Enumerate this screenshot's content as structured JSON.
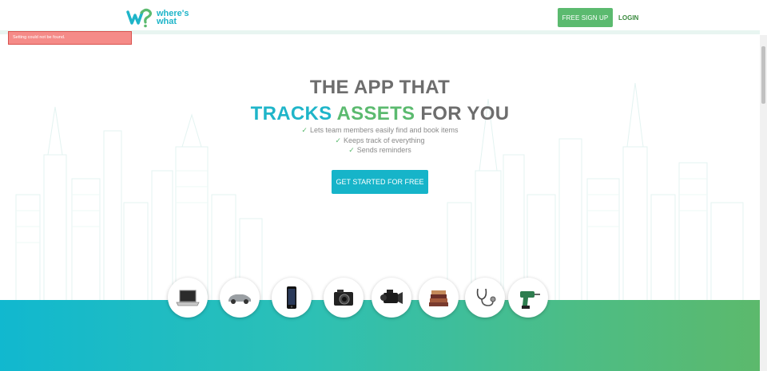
{
  "nav": {
    "logo_line1": "where's",
    "logo_line2": "what",
    "signup_label": "FREE SIGN UP",
    "login_label": "LOGIN"
  },
  "alert": {
    "message": "Setting could not be found."
  },
  "hero": {
    "title_line1": "THE APP THAT",
    "title_word1": "TRACKS",
    "title_word2": "ASSETS",
    "title_word3": "FOR YOU",
    "features": [
      "Lets team members easily find and book items",
      "Keeps track of everything",
      "Sends reminders"
    ],
    "cta_label": "GET STARTED FOR FREE"
  },
  "items": [
    {
      "name": "laptop-icon"
    },
    {
      "name": "car-icon"
    },
    {
      "name": "phone-icon"
    },
    {
      "name": "camera-icon"
    },
    {
      "name": "video-camera-icon"
    },
    {
      "name": "books-icon"
    },
    {
      "name": "stethoscope-icon"
    },
    {
      "name": "drill-icon"
    }
  ],
  "colors": {
    "teal": "#1fb5c9",
    "green": "#5bba6f",
    "alert_bg": "#f58b88",
    "title_gray": "#6d6d6d"
  }
}
